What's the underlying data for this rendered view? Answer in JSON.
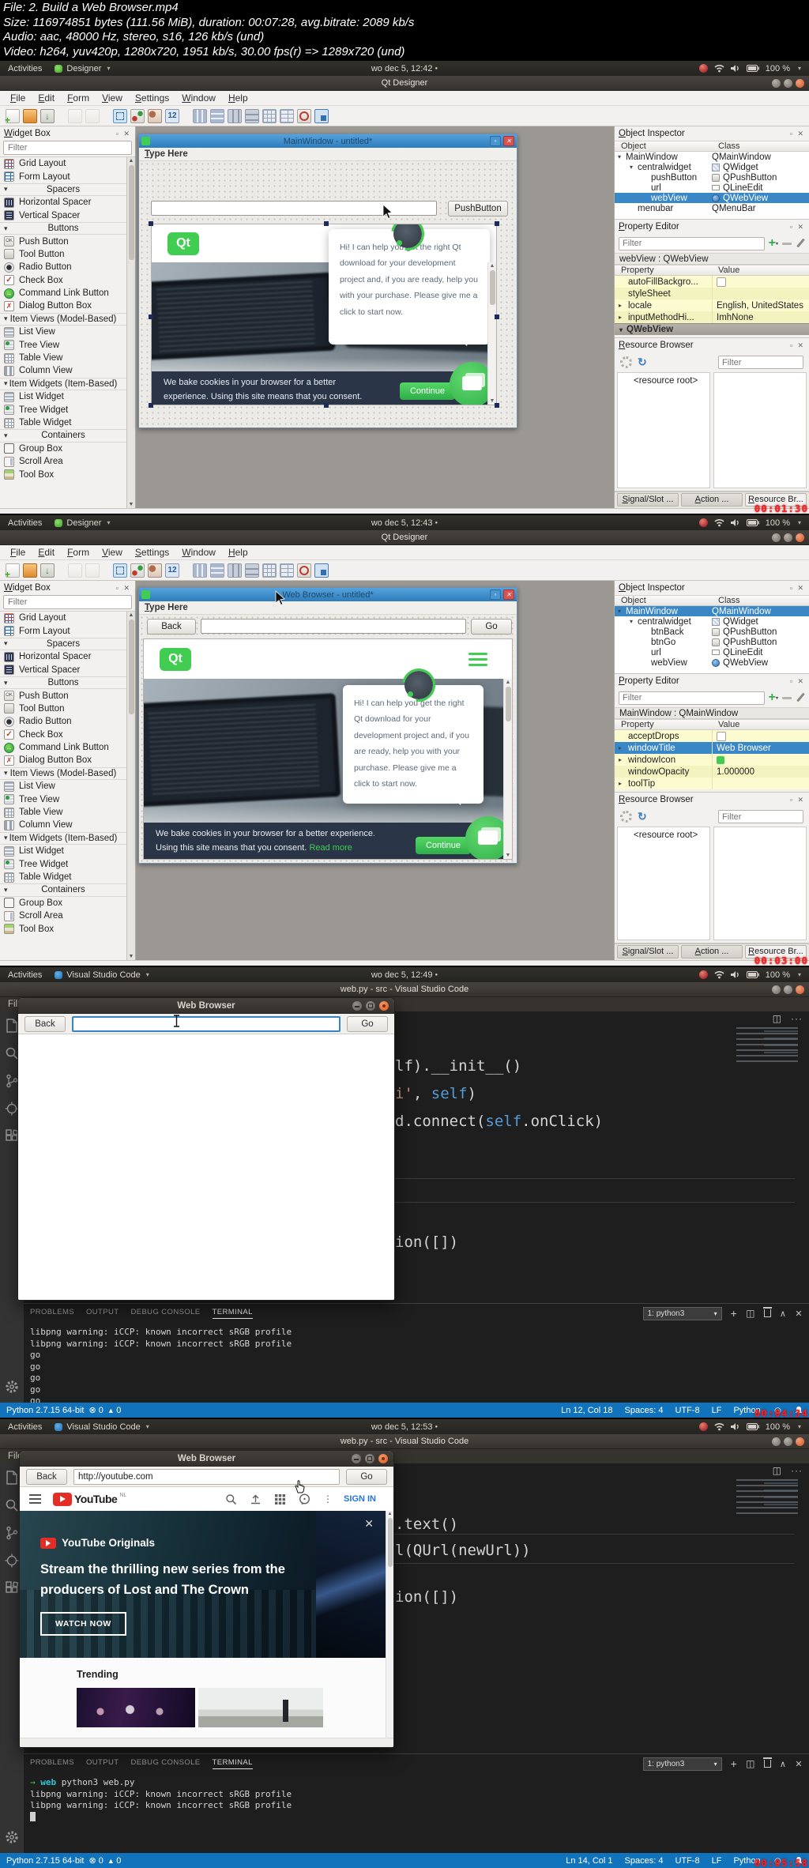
{
  "header": {
    "lines": [
      "File: 2. Build a Web Browser.mp4",
      "Size: 116974851 bytes (111.56 MiB), duration: 00:07:28, avg.bitrate: 2089 kb/s",
      "Audio: aac, 48000 Hz, stereo, s16, 126 kb/s (und)",
      "Video: h264, yuv420p, 1280x720, 1951 kb/s, 30.00 fps(r) => 1289x720 (und)"
    ]
  },
  "ubuntu": {
    "activities": "Activities",
    "battery": "100 %"
  },
  "qt": {
    "app_name": "Designer",
    "app_title": "Qt Designer",
    "menus": [
      "File",
      "Edit",
      "Form",
      "View",
      "Settings",
      "Window",
      "Help"
    ],
    "toolbar_icons": [
      {
        "name": "new-form-icon",
        "cls": "ti-new"
      },
      {
        "name": "open-form-icon",
        "cls": "ti-open"
      },
      {
        "name": "save-form-icon",
        "cls": "ti-save"
      },
      {
        "name": "separator",
        "cls": "tsep"
      },
      {
        "name": "copy-icon",
        "cls": "ti-copy"
      },
      {
        "name": "paste-icon",
        "cls": "ti-paste"
      },
      {
        "name": "separator",
        "cls": "tsep"
      },
      {
        "name": "edit-widgets-icon",
        "cls": "ti-edit"
      },
      {
        "name": "edit-signals-slots-icon",
        "cls": "ti-signals"
      },
      {
        "name": "edit-buddies-icon",
        "cls": "ti-buddies"
      },
      {
        "name": "edit-tab-order-icon",
        "cls": "ti-taborder"
      },
      {
        "name": "separator",
        "cls": "tsep"
      },
      {
        "name": "layout-vertically-icon",
        "cls": "ti-lay-v"
      },
      {
        "name": "layout-horizontally-icon",
        "cls": "ti-lay-h"
      },
      {
        "name": "layout-splitter-horizontal-icon",
        "cls": "ti-split-h"
      },
      {
        "name": "layout-splitter-vertical-icon",
        "cls": "ti-split-v"
      },
      {
        "name": "layout-grid-icon",
        "cls": "ti-grid"
      },
      {
        "name": "layout-form-icon",
        "cls": "ti-form"
      },
      {
        "name": "break-layout-icon",
        "cls": "ti-break"
      },
      {
        "name": "adjust-size-icon",
        "cls": "ti-adjust"
      }
    ],
    "widget_box": {
      "title": "Widget Box",
      "filter_placeholder": "Filter",
      "items": [
        {
          "t": "item",
          "icon": "i-grid",
          "label": "Grid Layout"
        },
        {
          "t": "item",
          "icon": "i-form",
          "label": "Form Layout"
        },
        {
          "t": "header",
          "label": "Spacers"
        },
        {
          "t": "item",
          "icon": "i-sph",
          "label": "Horizontal Spacer"
        },
        {
          "t": "item",
          "icon": "i-spv",
          "label": "Vertical Spacer"
        },
        {
          "t": "header",
          "label": "Buttons"
        },
        {
          "t": "item",
          "icon": "i-push",
          "label": "Push Button"
        },
        {
          "t": "item",
          "icon": "i-tool",
          "label": "Tool Button"
        },
        {
          "t": "item",
          "icon": "i-radio",
          "label": "Radio Button"
        },
        {
          "t": "item",
          "icon": "i-check",
          "label": "Check Box"
        },
        {
          "t": "item",
          "icon": "i-cmd",
          "label": "Command Link Button"
        },
        {
          "t": "item",
          "icon": "i-dlg",
          "label": "Dialog Button Box"
        },
        {
          "t": "header",
          "label": "Item Views (Model-Based)"
        },
        {
          "t": "item",
          "icon": "i-list",
          "label": "List View"
        },
        {
          "t": "item",
          "icon": "i-tree",
          "label": "Tree View"
        },
        {
          "t": "item",
          "icon": "i-table",
          "label": "Table View"
        },
        {
          "t": "item",
          "icon": "i-col",
          "label": "Column View"
        },
        {
          "t": "header",
          "label": "Item Widgets (Item-Based)"
        },
        {
          "t": "item",
          "icon": "i-list",
          "label": "List Widget"
        },
        {
          "t": "item",
          "icon": "i-tree",
          "label": "Tree Widget"
        },
        {
          "t": "item",
          "icon": "i-table",
          "label": "Table Widget"
        },
        {
          "t": "header",
          "label": "Containers"
        },
        {
          "t": "item",
          "icon": "i-group",
          "label": "Group Box"
        },
        {
          "t": "item",
          "icon": "i-scroll",
          "label": "Scroll Area"
        },
        {
          "t": "item",
          "icon": "i-toolbox",
          "label": "Tool Box"
        }
      ]
    },
    "object_inspector": {
      "title": "Object Inspector",
      "col_object": "Object",
      "col_class": "Class"
    },
    "property_editor": {
      "title": "Property Editor",
      "filter_placeholder": "Filter",
      "col_property": "Property",
      "col_value": "Value"
    },
    "resource_browser": {
      "title": "Resource Browser",
      "filter_placeholder": "Filter",
      "root": "<resource root>"
    },
    "dock_tabs": [
      "Signal/Slot ...",
      "Action ...",
      "Resource Br..."
    ],
    "form_menu_placeholder": "Type Here",
    "web": {
      "logo": "Qt",
      "chat": "Hi! I can help you get the right Qt download for your development project and, if you are ready, help you with your purchase. Please give me a click to start now.",
      "cookie": "We bake cookies in your browser for a better experience. Using this site means that you consent.",
      "read_more": "Read more",
      "continue_label": "Continue"
    }
  },
  "panel1": {
    "time": "wo dec 5, 12:42",
    "form_title": "MainWindow - untitled*",
    "push_button_label": "PushButton",
    "inspector_rows": [
      {
        "o": "MainWindow",
        "c": "QMainWindow",
        "cls": "ind0 exp",
        "ci": ""
      },
      {
        "o": "centralwidget",
        "c": "QWidget",
        "cls": "ind1 exp",
        "ci": "ci-widget"
      },
      {
        "o": "pushButton",
        "c": "QPushButton",
        "cls": "ind2",
        "ci": "ci-button"
      },
      {
        "o": "url",
        "c": "QLineEdit",
        "cls": "ind2",
        "ci": "ci-lineedit"
      },
      {
        "o": "webView",
        "c": "QWebView",
        "cls": "ind2 sel",
        "ci": "ci-webview"
      },
      {
        "o": "menubar",
        "c": "QMenuBar",
        "cls": "ind1",
        "ci": ""
      }
    ],
    "prop_header": "webView : QWebView",
    "prop_rows": [
      {
        "p": "autoFillBackgro...",
        "v": "",
        "cls": "",
        "vcls": "check"
      },
      {
        "p": "styleSheet",
        "v": "",
        "cls": "",
        "vcls": ""
      },
      {
        "p": "locale",
        "v": "English, UnitedStates",
        "cls": "arr",
        "vcls": ""
      },
      {
        "p": "inputMethodHi...",
        "v": "ImhNone",
        "cls": "arr",
        "vcls": ""
      }
    ],
    "prop_section": "QWebView",
    "timestamp": "00:01:30"
  },
  "panel2": {
    "time": "wo dec 5, 12:43",
    "form_title": "Web Browser - untitled*",
    "back_label": "Back",
    "go_label": "Go",
    "inspector_rows": [
      {
        "o": "MainWindow",
        "c": "QMainWindow",
        "cls": "ind0 exp sel",
        "ci": ""
      },
      {
        "o": "centralwidget",
        "c": "QWidget",
        "cls": "ind1 exp",
        "ci": "ci-widget"
      },
      {
        "o": "btnBack",
        "c": "QPushButton",
        "cls": "ind2",
        "ci": "ci-button"
      },
      {
        "o": "btnGo",
        "c": "QPushButton",
        "cls": "ind2",
        "ci": "ci-button"
      },
      {
        "o": "url",
        "c": "QLineEdit",
        "cls": "ind2",
        "ci": "ci-lineedit"
      },
      {
        "o": "webView",
        "c": "QWebView",
        "cls": "ind2",
        "ci": "ci-webview"
      }
    ],
    "prop_header": "MainWindow : QMainWindow",
    "prop_rows": [
      {
        "p": "acceptDrops",
        "v": "",
        "cls": "",
        "vcls": "check"
      },
      {
        "p": "windowTitle",
        "v": "Web Browser",
        "cls": "sel arr",
        "vcls": ""
      },
      {
        "p": "windowIcon",
        "v": "",
        "cls": "arr",
        "vcls": "icon"
      },
      {
        "p": "windowOpacity",
        "v": "1.000000",
        "cls": "",
        "vcls": ""
      },
      {
        "p": "toolTip",
        "v": "",
        "cls": "arr",
        "vcls": ""
      }
    ],
    "timestamp": "00:03:00"
  },
  "vscode": {
    "app_name": "Visual Studio Code",
    "menu_file": "File",
    "panel_tabs": [
      "PROBLEMS",
      "OUTPUT",
      "DEBUG CONSOLE",
      "TERMINAL"
    ],
    "shell": "1: python3",
    "status_left": "Python 2.7.15 64-bit",
    "errors": "0",
    "warnings": "0",
    "spaces": "Spaces: 4",
    "encoding": "UTF-8",
    "eol": "LF",
    "language": "Python"
  },
  "panel3": {
    "time": "wo dec 5, 12:49",
    "window_title": "web.py - src - Visual Studio Code",
    "browser": {
      "title": "Web Browser",
      "back": "Back",
      "url": "",
      "go": "Go"
    },
    "code_lines": [
      {
        "cls": "p3l1",
        "segs": [
          {
            "c": "w",
            "t": "lf).__init__()"
          }
        ]
      },
      {
        "cls": "p3l2",
        "segs": [
          {
            "c": "s",
            "t": "i'"
          },
          {
            "c": "w",
            "t": ", "
          },
          {
            "c": "b",
            "t": "self"
          },
          {
            "c": "w",
            "t": ")"
          }
        ]
      },
      {
        "cls": "p3l3",
        "segs": [
          {
            "c": "w",
            "t": "d.connect("
          },
          {
            "c": "b",
            "t": "self"
          },
          {
            "c": "w",
            "t": ".onClick)"
          }
        ]
      },
      {
        "cls": "p3l4",
        "segs": [
          {
            "c": "w",
            "t": "ion([])"
          }
        ]
      }
    ],
    "terminal_lines": [
      {
        "segs": [
          {
            "c": "w",
            "t": "libpng warning: iCCP: known incorrect sRGB profile"
          }
        ]
      },
      {
        "segs": [
          {
            "c": "w",
            "t": "libpng warning: iCCP: known incorrect sRGB profile"
          }
        ]
      },
      {
        "segs": [
          {
            "c": "w",
            "t": "go"
          }
        ]
      },
      {
        "segs": [
          {
            "c": "w",
            "t": "go"
          }
        ]
      },
      {
        "segs": [
          {
            "c": "w",
            "t": "go"
          }
        ]
      },
      {
        "segs": [
          {
            "c": "w",
            "t": "go"
          }
        ]
      },
      {
        "segs": [
          {
            "c": "w",
            "t": "go"
          }
        ]
      }
    ],
    "status_position": "Ln 12, Col 18",
    "timestamp": "00:04:34"
  },
  "panel4": {
    "time": "wo dec 5, 12:53",
    "window_title": "web.py - src - Visual Studio Code",
    "browser": {
      "title": "Web Browser",
      "back": "Back",
      "url": "http://youtube.com",
      "go": "Go"
    },
    "youtube": {
      "brand": "YouTube",
      "region": "NL",
      "sign_in": "SIGN IN",
      "originals": "YouTube Originals",
      "headline": "Stream the thrilling new series from the producers of Lost and The Crown",
      "watch_now": "WATCH NOW",
      "trending": "Trending"
    },
    "code_lines": [
      {
        "cls": "p4l1",
        "segs": [
          {
            "c": "w",
            "t": ".text()"
          }
        ]
      },
      {
        "cls": "p4l2",
        "segs": [
          {
            "c": "w",
            "t": "l(QUrl(newUrl))"
          }
        ]
      },
      {
        "cls": "p4l3",
        "segs": [
          {
            "c": "w",
            "t": "ion([])"
          }
        ]
      }
    ],
    "terminal_lines": [
      {
        "segs": [
          {
            "c": "g",
            "t": "→ "
          },
          {
            "c": "t",
            "t": "web"
          },
          {
            "c": "w",
            "t": " python3 web.py"
          }
        ]
      },
      {
        "segs": [
          {
            "c": "w",
            "t": "libpng warning: iCCP: known incorrect sRGB profile"
          }
        ]
      },
      {
        "segs": [
          {
            "c": "w",
            "t": "libpng warning: iCCP: known incorrect sRGB profile"
          }
        ]
      }
    ],
    "status_position": "Ln 14, Col 1",
    "timestamp": "00:05:58"
  }
}
